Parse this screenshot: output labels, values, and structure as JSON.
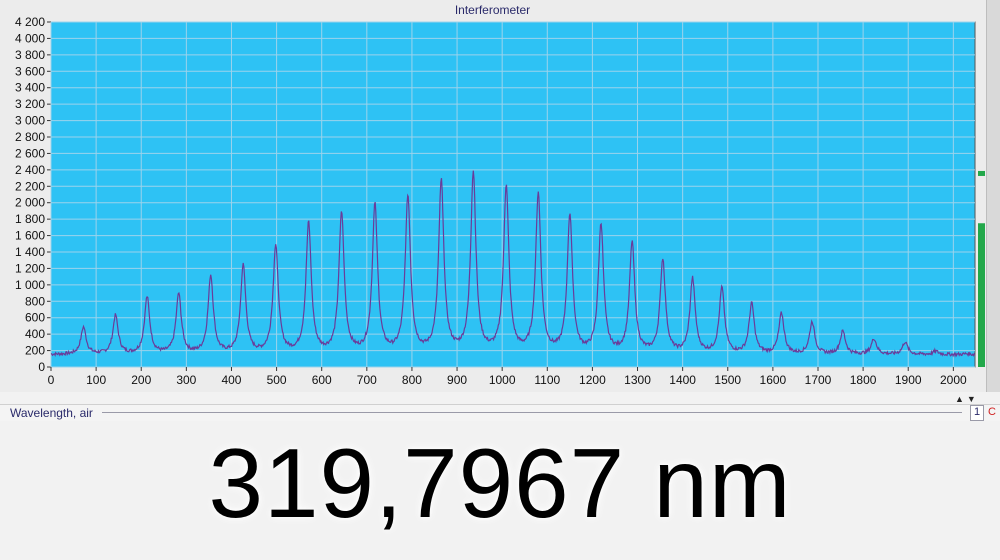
{
  "window": {
    "title": "Interferometer"
  },
  "colors": {
    "plot_bg": "#2ec2f4",
    "trace": "#6a3c9a",
    "grid": "#9cd3ec",
    "level_bar": "#22a84a"
  },
  "chart_data": {
    "type": "line",
    "title": "Interferometer",
    "xlabel": "",
    "ylabel": "",
    "xlim": [
      0,
      2048
    ],
    "ylim": [
      0,
      4200
    ],
    "x_ticks": [
      "0",
      "100",
      "200",
      "300",
      "400",
      "500",
      "600",
      "700",
      "800",
      "900",
      "1000",
      "1100",
      "1200",
      "1300",
      "1400",
      "1500",
      "1600",
      "1700",
      "1800",
      "1900",
      "2000"
    ],
    "y_ticks": [
      "0",
      "200",
      "400",
      "600",
      "800",
      "1 000",
      "1 200",
      "1 400",
      "1 600",
      "1 800",
      "2 000",
      "2 200",
      "2 400",
      "2 600",
      "2 800",
      "3 000",
      "3 200",
      "3 400",
      "3 600",
      "3 800",
      "4 000",
      "4 200"
    ],
    "grid": true,
    "baseline": 150,
    "fringe_width": 7,
    "series": [
      {
        "peaks": [
          {
            "x": 72,
            "y": 480
          },
          {
            "x": 143,
            "y": 620
          },
          {
            "x": 213,
            "y": 840
          },
          {
            "x": 283,
            "y": 880
          },
          {
            "x": 354,
            "y": 1100
          },
          {
            "x": 426,
            "y": 1220
          },
          {
            "x": 498,
            "y": 1460
          },
          {
            "x": 571,
            "y": 1740
          },
          {
            "x": 644,
            "y": 1860
          },
          {
            "x": 718,
            "y": 1960
          },
          {
            "x": 791,
            "y": 2060
          },
          {
            "x": 865,
            "y": 2240
          },
          {
            "x": 936,
            "y": 2340
          },
          {
            "x": 1009,
            "y": 2180
          },
          {
            "x": 1080,
            "y": 2090
          },
          {
            "x": 1150,
            "y": 1830
          },
          {
            "x": 1219,
            "y": 1720
          },
          {
            "x": 1288,
            "y": 1500
          },
          {
            "x": 1356,
            "y": 1290
          },
          {
            "x": 1422,
            "y": 1060
          },
          {
            "x": 1487,
            "y": 950
          },
          {
            "x": 1553,
            "y": 760
          },
          {
            "x": 1619,
            "y": 640
          },
          {
            "x": 1687,
            "y": 540
          },
          {
            "x": 1755,
            "y": 430
          },
          {
            "x": 1824,
            "y": 340
          },
          {
            "x": 1893,
            "y": 300
          },
          {
            "x": 1961,
            "y": 190
          },
          {
            "x": 2030,
            "y": 160
          }
        ]
      }
    ]
  },
  "side_meter": {
    "level": 1750,
    "marker": 2350
  },
  "wavelength_field": {
    "label": "Wavelength,  air",
    "channel": "1",
    "channel_letter": "C"
  },
  "readout": {
    "value": "319,7967 nm"
  }
}
